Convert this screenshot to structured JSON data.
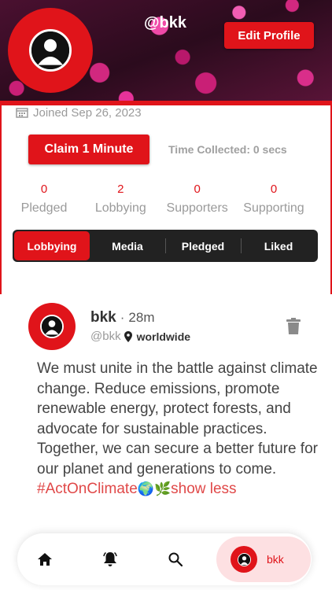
{
  "profile": {
    "handle": "@bkk",
    "edit_label": "Edit Profile",
    "joined": "Joined Sep 26, 2023",
    "claim_label": "Claim 1 Minute",
    "time_collected": "Time Collected: 0 secs"
  },
  "stats": [
    {
      "value": "0",
      "label": "Pledged"
    },
    {
      "value": "2",
      "label": "Lobbying"
    },
    {
      "value": "0",
      "label": "Supporters"
    },
    {
      "value": "0",
      "label": "Supporting"
    }
  ],
  "tabs": [
    {
      "label": "Lobbying",
      "active": true
    },
    {
      "label": "Media",
      "active": false
    },
    {
      "label": "Pledged",
      "active": false
    },
    {
      "label": "Liked",
      "active": false
    }
  ],
  "post": {
    "name": "bkk",
    "separator": "·",
    "time": "28m",
    "handle": "@bkk",
    "location": "worldwide",
    "body": "We must unite in the battle against climate change. Reduce emissions, promote renewable energy, protect forests, and advocate for sustainable practices. Together, we can secure a better future for our planet and generations to come.",
    "hashtag": "#ActOnClimate",
    "emojis": "🌍🌿",
    "show_less": "show less"
  },
  "nav": {
    "profile_label": "bkk"
  },
  "icons": {
    "calendar": "calendar-icon",
    "pin": "location-pin-icon",
    "trash": "trash-icon",
    "home": "home-icon",
    "bell": "bell-icon",
    "search": "search-icon",
    "avatar": "user-avatar-icon"
  },
  "colors": {
    "accent": "#e0141a",
    "muted": "#9a9a9a",
    "tab_bar": "#222222",
    "hashtag": "#e04848"
  }
}
